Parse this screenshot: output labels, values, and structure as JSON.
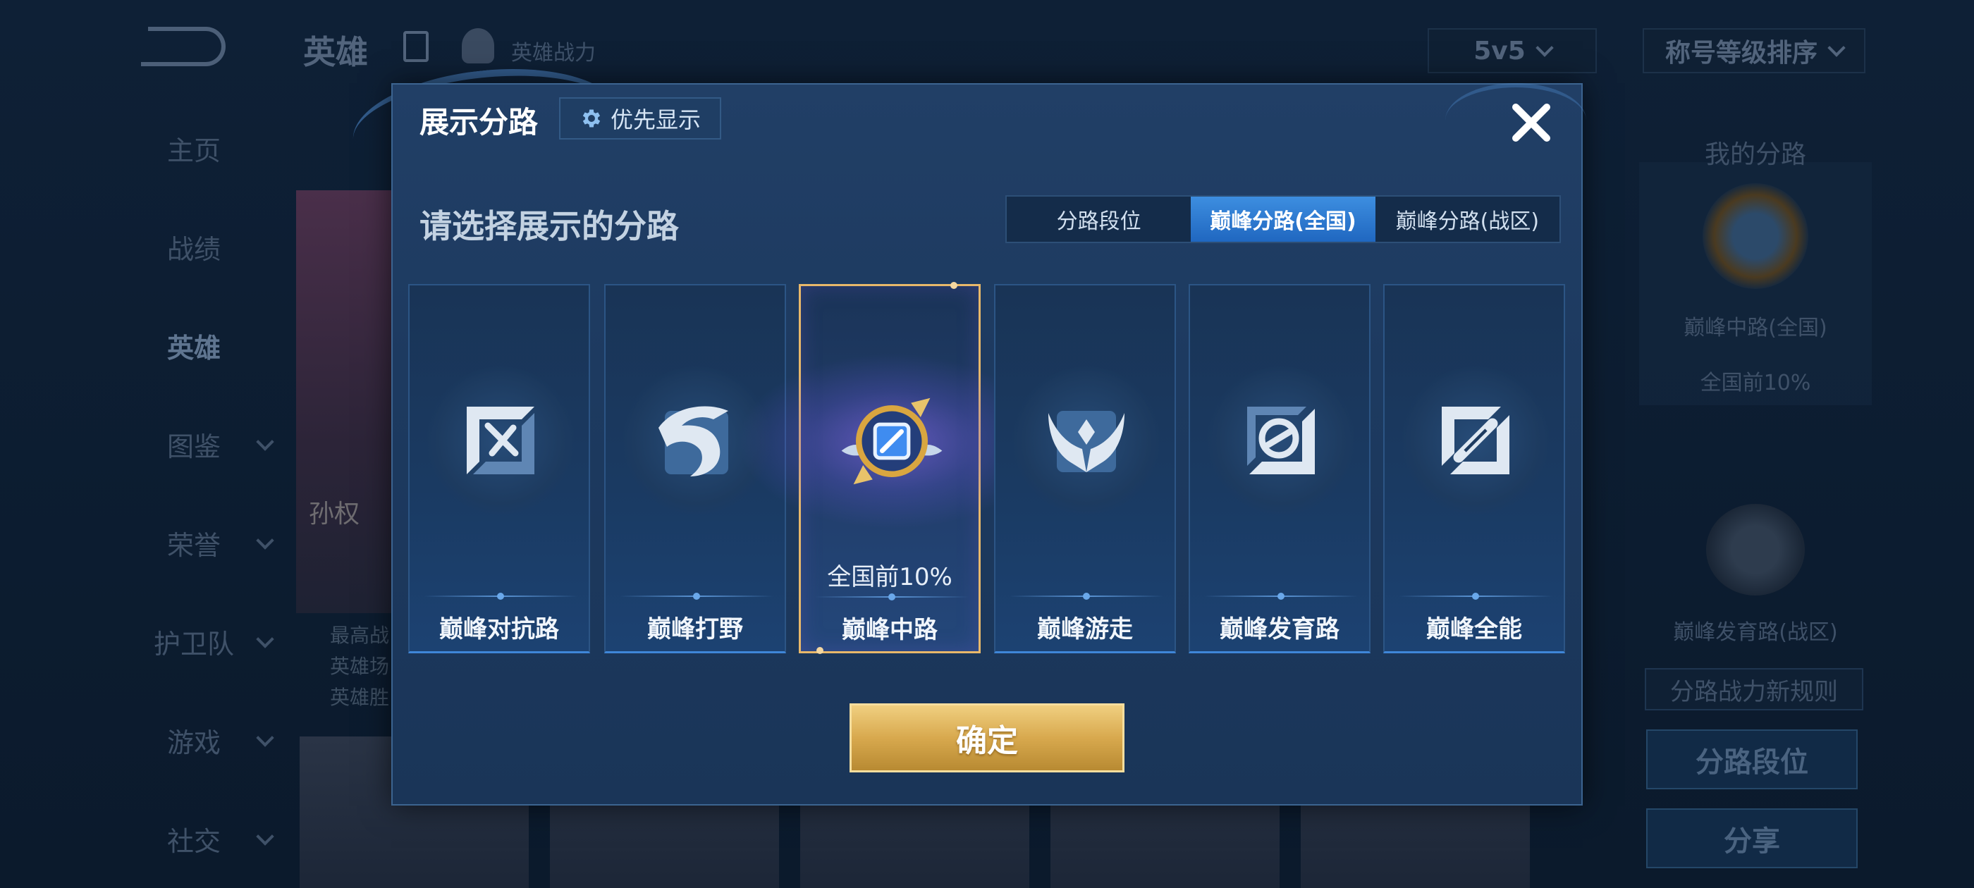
{
  "background": {
    "top_bar": {
      "title": "英雄",
      "hero_power_label": "英雄战力",
      "mode_select": "5v5",
      "sort_select": "称号等级排序"
    },
    "sidebar": {
      "items": [
        {
          "label": "主页"
        },
        {
          "label": "战绩"
        },
        {
          "label": "英雄"
        },
        {
          "label": "图鉴"
        },
        {
          "label": "荣誉"
        },
        {
          "label": "护卫队"
        },
        {
          "label": "游戏"
        },
        {
          "label": "社交"
        }
      ]
    },
    "hero_card": {
      "name": "孙权",
      "stats": [
        "最高战",
        "英雄场",
        "英雄胜"
      ]
    },
    "right_panel": {
      "title": "我的分路",
      "primary_lane": "巅峰中路(全国)",
      "primary_rank": "全国前10%",
      "secondary_lane": "巅峰发育路(战区)",
      "rules_button": "分路战力新规则",
      "rank_button": "分路段位",
      "share_button": "分享"
    }
  },
  "modal": {
    "title": "展示分路",
    "priority_button": "优先显示",
    "prompt": "请选择展示的分路",
    "segments": [
      "分路段位",
      "巅峰分路(全国)",
      "巅峰分路(战区)"
    ],
    "active_segment": "巅峰分路(全国)",
    "roles": [
      {
        "label": "巅峰对抗路",
        "icon": "clash-lane-icon",
        "rank": ""
      },
      {
        "label": "巅峰打野",
        "icon": "jungle-icon",
        "rank": ""
      },
      {
        "label": "巅峰中路",
        "icon": "mid-lane-icon",
        "rank": "全国前10%",
        "selected": true
      },
      {
        "label": "巅峰游走",
        "icon": "roam-icon",
        "rank": ""
      },
      {
        "label": "巅峰发育路",
        "icon": "farm-lane-icon",
        "rank": ""
      },
      {
        "label": "巅峰全能",
        "icon": "all-round-icon",
        "rank": ""
      }
    ],
    "confirm_button": "确定"
  },
  "colors": {
    "modal_bg": "#1d3a60",
    "accent_blue": "#2f7ed6",
    "gold": "#d8a94e",
    "selected_border": "#e8b86a"
  }
}
